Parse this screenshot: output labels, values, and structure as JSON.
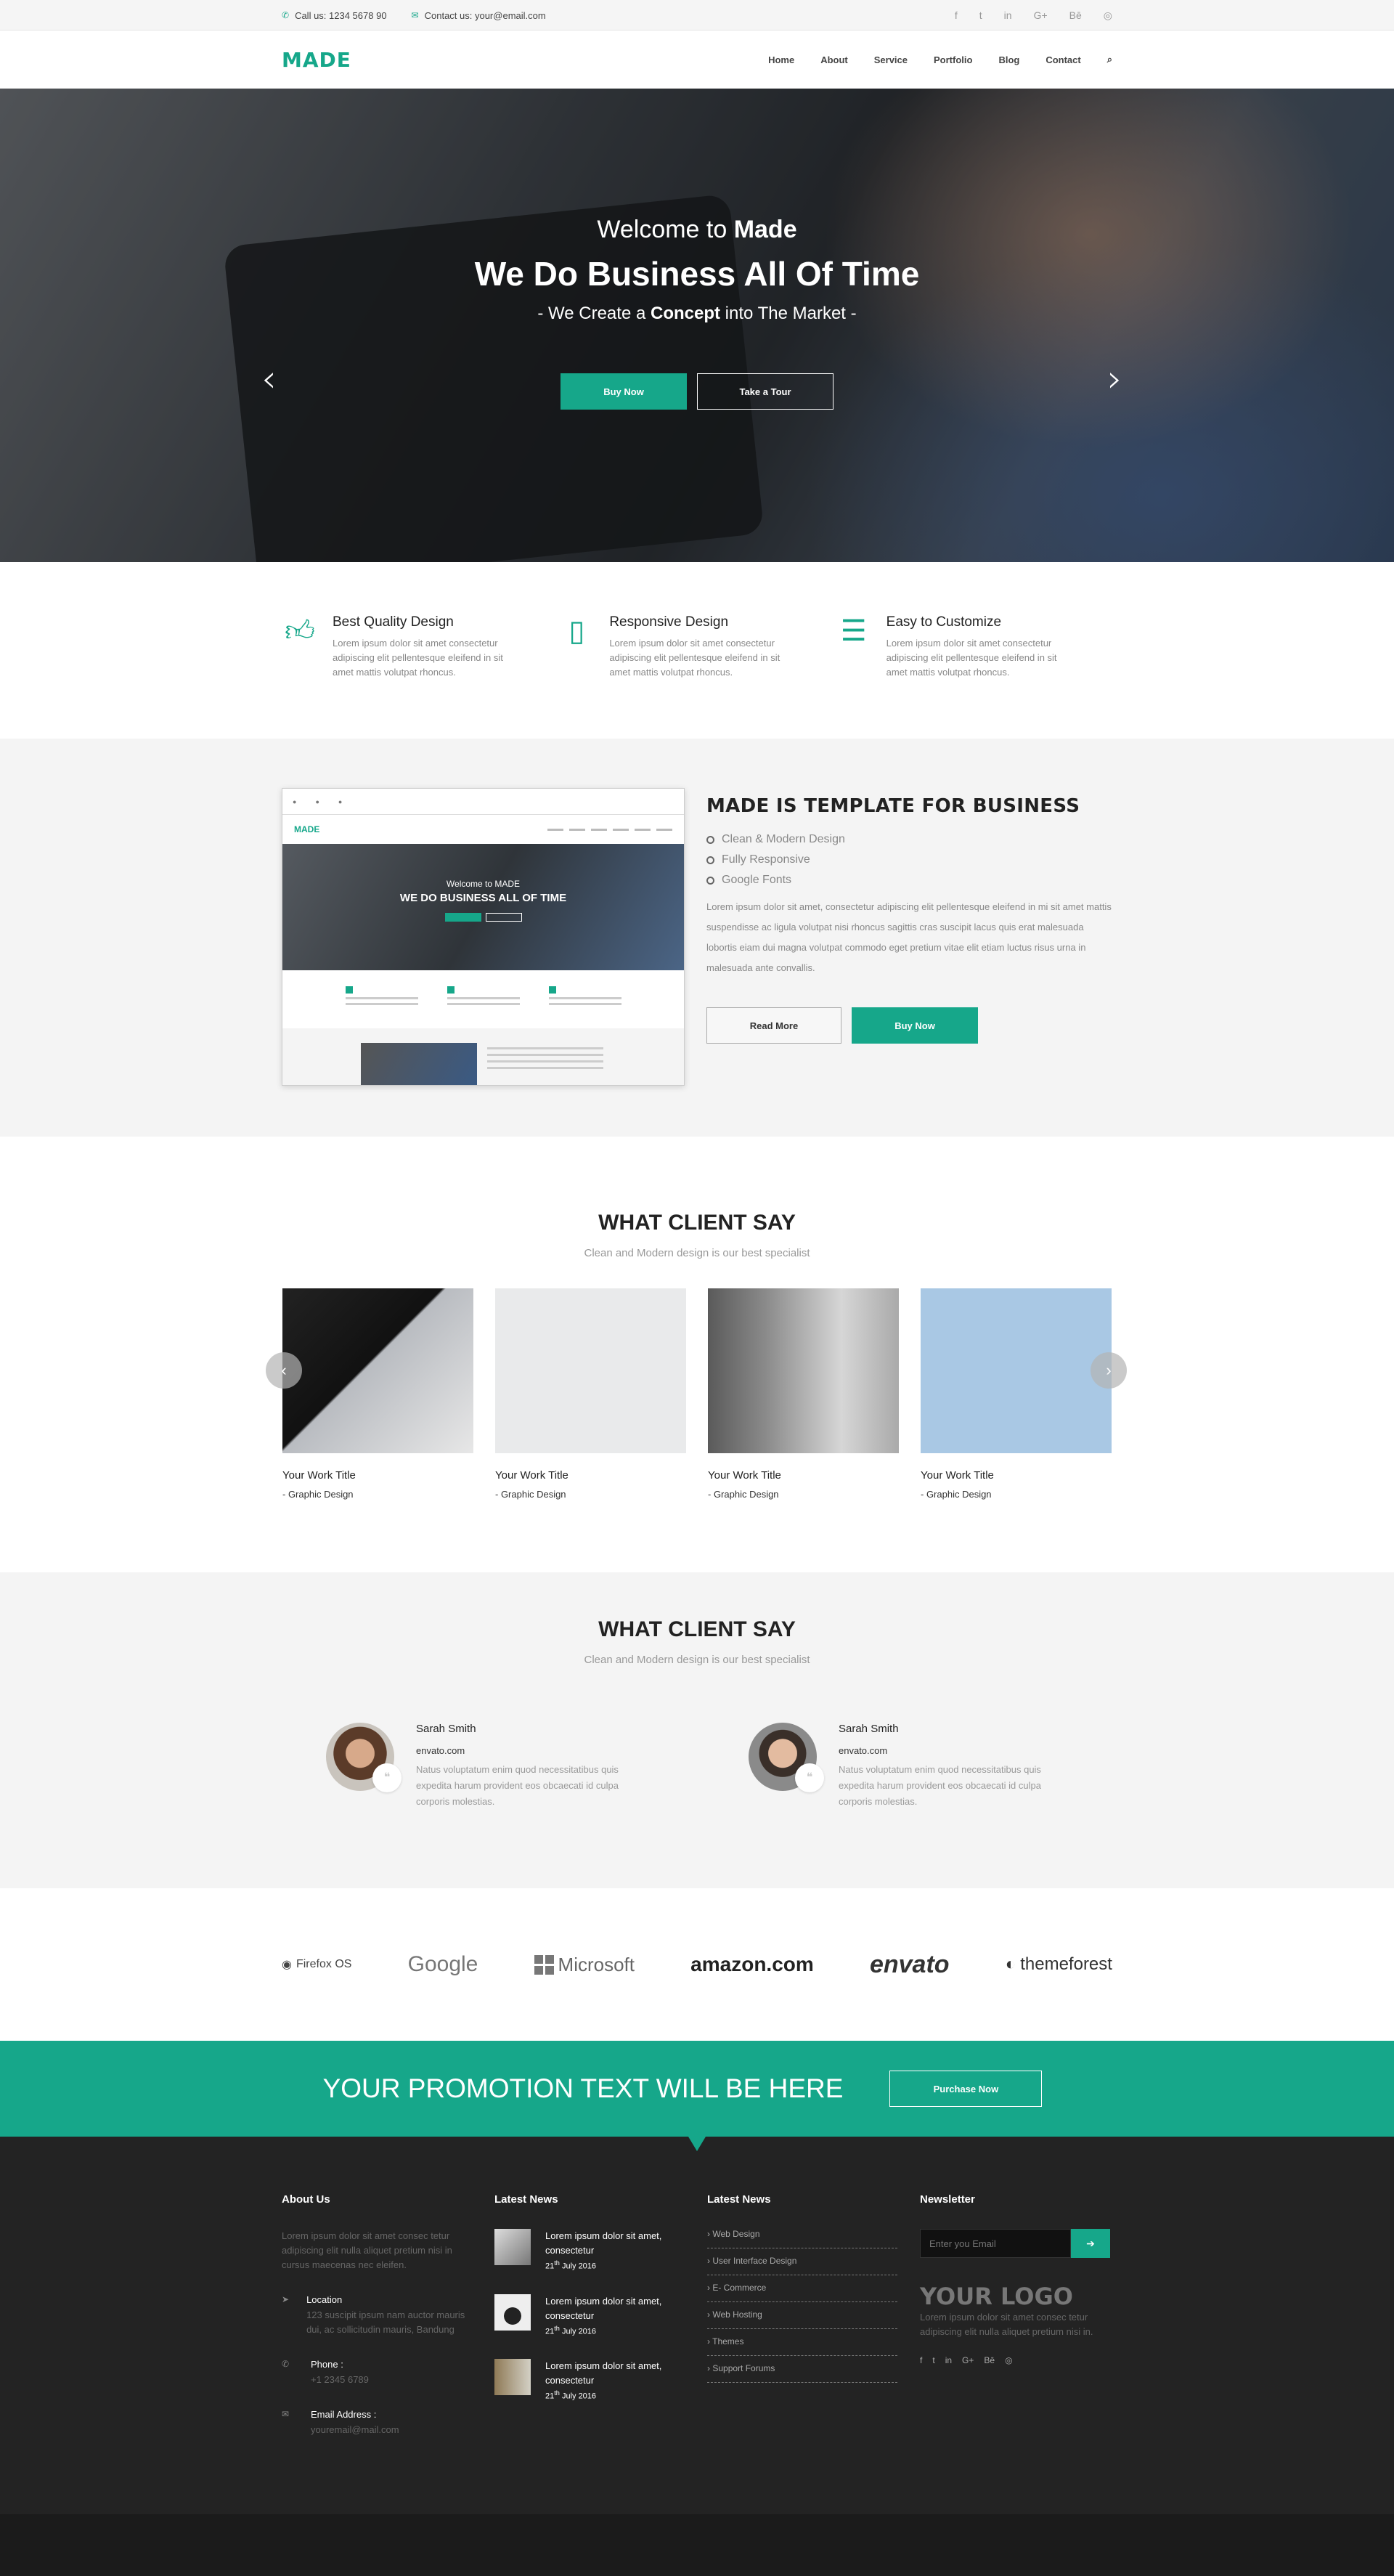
{
  "topbar": {
    "phone": "Call us: 1234 5678 90",
    "email": "Contact us: your@email.com",
    "social": [
      "f",
      "t",
      "in",
      "G+",
      "Bē",
      "◎"
    ]
  },
  "header": {
    "logo": "MADE",
    "nav": [
      "Home",
      "About",
      "Service",
      "Portfolio",
      "Blog",
      "Contact"
    ]
  },
  "hero": {
    "welcome_prefix": "Welcome to ",
    "welcome_brand": "Made",
    "headline": "We Do Business All Of Time",
    "sub_prefix": "- We Create a ",
    "sub_bold": "Concept",
    "sub_suffix": " into The Market -",
    "buy_now": "Buy Now",
    "take_tour": "Take a Tour"
  },
  "features": [
    {
      "title": "Best Quality Design",
      "text": "Lorem ipsum dolor sit amet consectetur adipiscing elit pellentesque eleifend in sit amet mattis volutpat rhoncus.",
      "icon": "thumbs-up-icon"
    },
    {
      "title": "Responsive Design",
      "text": "Lorem ipsum dolor sit amet consectetur adipiscing elit pellentesque eleifend in sit amet mattis volutpat rhoncus.",
      "icon": "tablet-icon"
    },
    {
      "title": "Easy to Customize",
      "text": "Lorem ipsum dolor sit amet consectetur adipiscing elit pellentesque eleifend in sit amet mattis volutpat rhoncus.",
      "icon": "sliders-icon"
    }
  ],
  "template": {
    "title": "MADE IS TEMPLATE FOR BUSINESS",
    "list": [
      "Clean & Modern Design",
      "Fully Responsive",
      "Google Fonts"
    ],
    "text": "Lorem ipsum dolor sit amet, consectetur adipiscing elit pellentesque eleifend in mi sit amet mattis suspendisse ac ligula volutpat nisi rhoncus sagittis cras suscipit lacus quis erat malesuada lobortis eiam dui magna volutpat commodo eget pretium vitae elit etiam luctus risus urna in malesuada ante convallis.",
    "read_more": "Read More",
    "buy_now": "Buy Now",
    "mock_welcome": "Welcome to MADE",
    "mock_headline": "WE DO BUSINESS ALL OF TIME",
    "mock_logo": "MADE"
  },
  "works": {
    "title": "WHAT CLIENT SAY",
    "subtitle": "Clean and Modern design is our best specialist",
    "items": [
      {
        "title": "Your Work Title",
        "category": "- Graphic Design"
      },
      {
        "title": "Your Work Title",
        "category": "- Graphic Design"
      },
      {
        "title": "Your Work Title",
        "category": "- Graphic Design"
      },
      {
        "title": "Your Work Title",
        "category": "- Graphic Design"
      }
    ]
  },
  "testimonials": {
    "title": "WHAT CLIENT SAY",
    "subtitle": "Clean and Modern design is our best specialist",
    "items": [
      {
        "name": "Sarah Smith",
        "site": "envato.com",
        "text": "Natus voluptatum enim quod necessitatibus quis expedita harum provident eos obcaecati id culpa corporis molestias."
      },
      {
        "name": "Sarah Smith",
        "site": "envato.com",
        "text": "Natus voluptatum enim quod necessitatibus quis expedita harum provident eos obcaecati id culpa corporis molestias."
      }
    ]
  },
  "clients": [
    "Firefox OS",
    "Google",
    "Microsoft",
    "amazon.com",
    "envato",
    "themeforest"
  ],
  "promo": {
    "text": "YOUR PROMOTION TEXT WILL BE HERE",
    "button": "Purchase Now"
  },
  "footer": {
    "about_title": "About Us",
    "about_text": "Lorem ipsum dolor sit amet consec tetur adipiscing elit nulla aliquet pretium nisi in cursus maecenas nec eleifen.",
    "location_label": "Location",
    "location_value": "123 suscipit ipsum nam auctor mauris dui, ac sollicitudin mauris, Bandung",
    "phone_label": "Phone :",
    "phone_value": "+1 2345 6789",
    "email_label": "Email Address :",
    "email_value": "youremail@mail.com",
    "news_title": "Latest News",
    "news": [
      {
        "text": "Lorem ipsum dolor sit amet, consectetur",
        "day": "21",
        "sup": "th",
        "date": " July 2016"
      },
      {
        "text": "Lorem ipsum dolor sit amet, consectetur",
        "day": "21",
        "sup": "th",
        "date": " July 2016"
      },
      {
        "text": "Lorem ipsum dolor sit amet, consectetur",
        "day": "21",
        "sup": "th",
        "date": " July 2016"
      }
    ],
    "links_title": "Latest News",
    "links": [
      "Web Design",
      "User Interface Design",
      "E- Commerce",
      "Web Hosting",
      "Themes",
      "Support Forums"
    ],
    "newsletter_title": "Newsletter",
    "newsletter_placeholder": "Enter you Email",
    "logo": "YOUR LOGO",
    "logo_text": "Lorem ipsum dolor sit amet consec tetur adipiscing elit nulla aliquet pretium nisi in.",
    "social": [
      "f",
      "t",
      "in",
      "G+",
      "Bē",
      "◎"
    ]
  }
}
